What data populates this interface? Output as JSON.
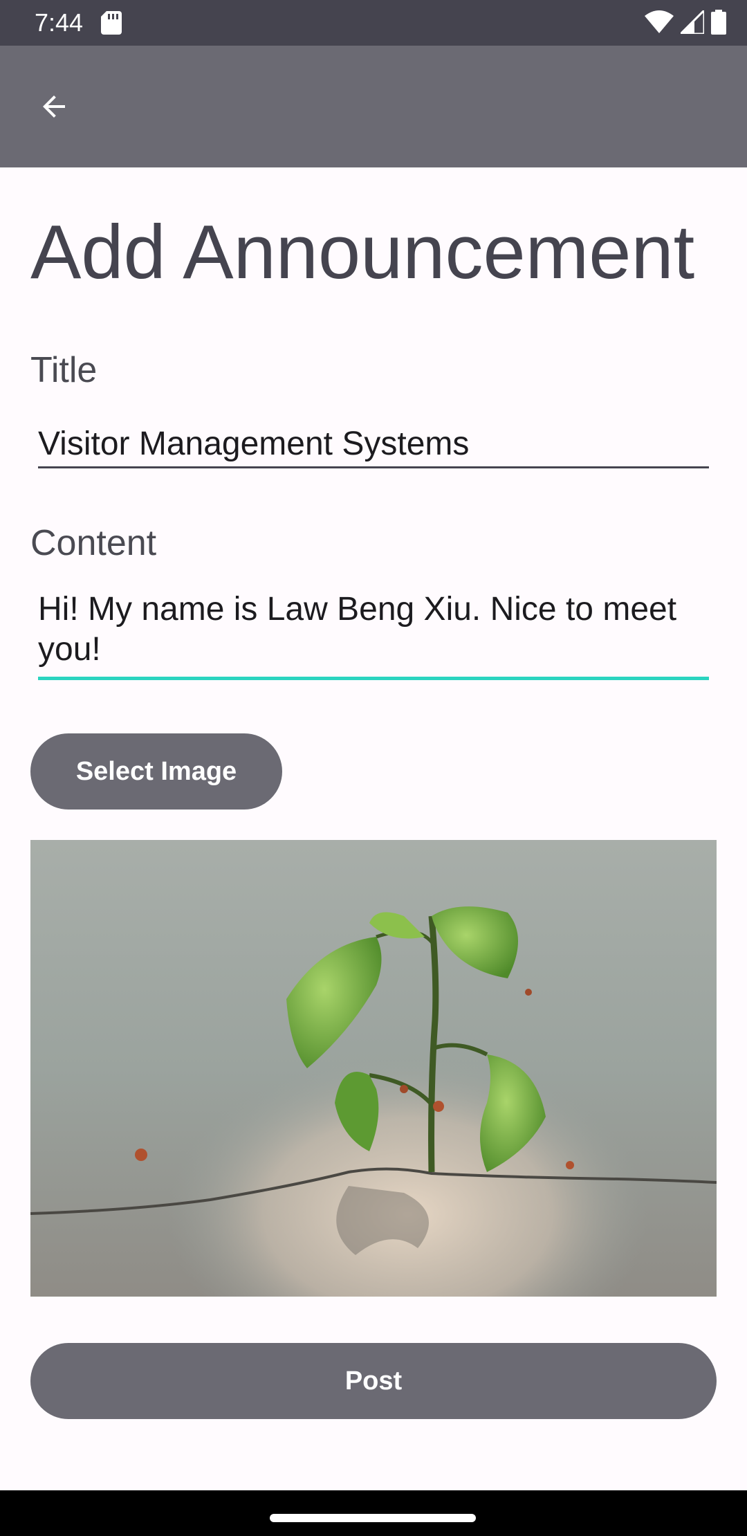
{
  "status_bar": {
    "time": "7:44",
    "icons": [
      "sd-card-icon",
      "wifi-icon",
      "signal-icon",
      "battery-icon"
    ]
  },
  "app_bar": {
    "back_icon": "arrow-back-icon"
  },
  "page": {
    "title": "Add Announcement"
  },
  "form": {
    "title_label": "Title",
    "title_value": "Visitor Management Systems",
    "content_label": "Content",
    "content_value": "Hi! My name is Law Beng Xiu. Nice to meet you!"
  },
  "buttons": {
    "select_image_label": "Select Image",
    "post_label": "Post"
  },
  "colors": {
    "status_bar": "#45444f",
    "app_bar": "#6b6a73",
    "background": "#fffbfe",
    "focus_underline": "#2bd4c0",
    "button": "#6b6a73"
  }
}
